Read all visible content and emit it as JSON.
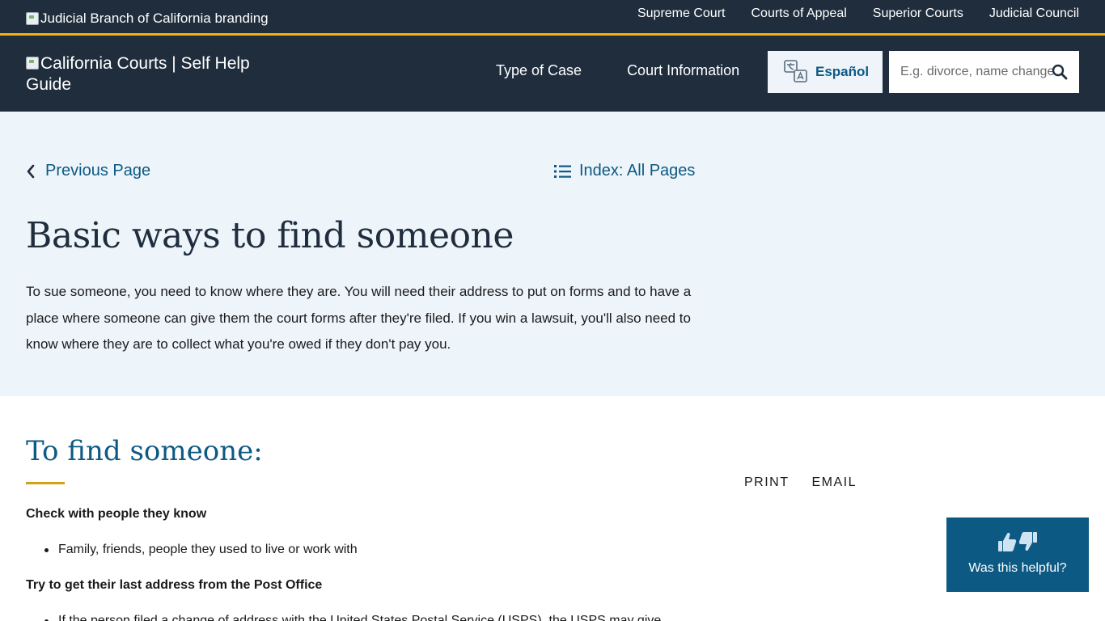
{
  "utility_bar": {
    "branding_alt": "Judicial Branch of California branding",
    "links": [
      "Supreme Court",
      "Courts of Appeal",
      "Superior Courts",
      "Judicial Council"
    ]
  },
  "header": {
    "logo_alt": "California Courts | Self Help Guide",
    "nav": [
      "Type of Case",
      "Court Information"
    ],
    "language_button": "Español",
    "search_placeholder": "E.g. divorce, name change,"
  },
  "hero": {
    "prev_link": "Previous Page",
    "index_link": "Index: All Pages",
    "title": "Basic ways to find someone",
    "intro": "To sue someone, you need to know where they are. You will need their address to put on forms and to have a place where someone can give them the court forms after they're filed. If you win a lawsuit, you'll also need to know where they are to collect what you're owed if they don't pay you."
  },
  "content": {
    "heading": "To find someone:",
    "actions": [
      "PRINT",
      "EMAIL"
    ],
    "sections": [
      {
        "title": "Check with people they know",
        "bullets": [
          "Family, friends, people they used to live or work with"
        ]
      },
      {
        "title": "Try to get their last address from the Post Office",
        "bullets": [
          "If the person filed a change of address with the United States Postal Service (USPS), the USPS may give"
        ]
      }
    ]
  },
  "feedback": {
    "label": "Was this helpful?"
  },
  "colors": {
    "navy": "#1f2d3d",
    "gold": "#f2b20f",
    "link_blue": "#0c5983",
    "hero_bg": "#edf4fa"
  }
}
